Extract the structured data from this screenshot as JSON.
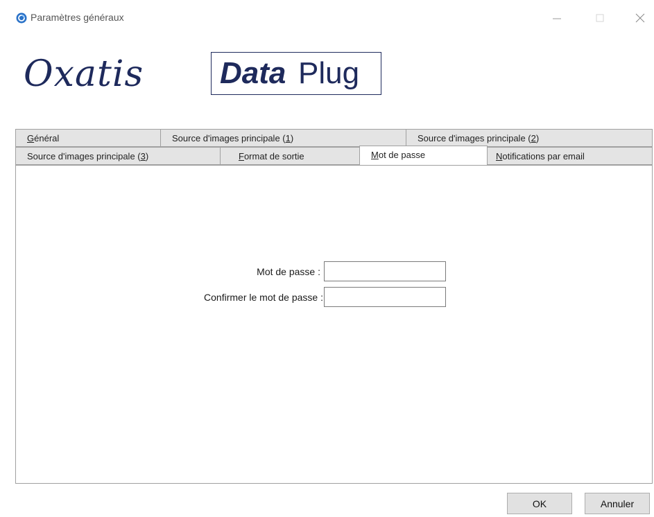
{
  "window": {
    "title": "Paramètres généraux"
  },
  "logo": {
    "brand_word": "Oxatis",
    "product_bold": "Data",
    "product_regular": "Plug",
    "color": "#1e2a5c"
  },
  "tabs": {
    "row1": [
      {
        "label": "Général",
        "accel": "G",
        "rest": "énéral"
      },
      {
        "label": "Source d'images principale (1)",
        "before": "Source d'images principale (",
        "accel": "1",
        "after": ")"
      },
      {
        "label": "Source d'images principale (2)",
        "before": "Source d'images principale (",
        "accel": "2",
        "after": ")"
      }
    ],
    "row2": [
      {
        "label": "Source d'images principale (3)",
        "before": "Source d'images principale (",
        "accel": "3",
        "after": ")"
      },
      {
        "label": "Format de sortie",
        "accel": "F",
        "rest": "ormat de sortie"
      },
      {
        "label": "Mot de passe",
        "accel": "M",
        "rest": "ot de passe",
        "active": true
      },
      {
        "label": "Notifications par email",
        "accel": "N",
        "rest": "otifications par email"
      }
    ]
  },
  "form": {
    "password_label": "Mot de passe :",
    "password_value": "",
    "confirm_label": "Confirmer le mot de passe :",
    "confirm_value": ""
  },
  "buttons": {
    "ok": "OK",
    "cancel": "Annuler"
  }
}
